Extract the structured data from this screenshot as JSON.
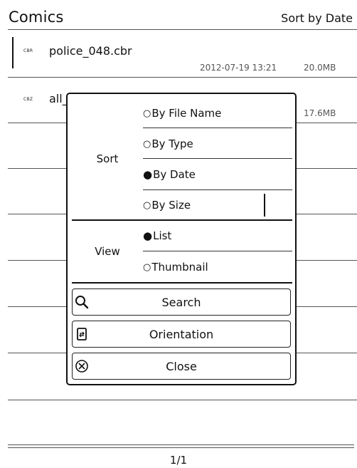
{
  "header": {
    "title": "Comics",
    "sort_label": "Sort by Date"
  },
  "files": [
    {
      "type": "CBR",
      "name": "police_048.cbr",
      "date": "2012-07-19 13:21",
      "size": "20.0MB"
    },
    {
      "type": "CBZ",
      "name": "all_",
      "size": "17.6MB"
    }
  ],
  "modal": {
    "sort_group_label": "Sort",
    "sort_options": [
      {
        "label": "By File Name",
        "selected": false
      },
      {
        "label": "By Type",
        "selected": false
      },
      {
        "label": "By Date",
        "selected": true
      },
      {
        "label": "By Size",
        "selected": false
      }
    ],
    "view_group_label": "View",
    "view_options": [
      {
        "label": "List",
        "selected": true
      },
      {
        "label": "Thumbnail",
        "selected": false
      }
    ],
    "buttons": {
      "search": "Search",
      "orientation": "Orientation",
      "close": "Close"
    },
    "marks": {
      "empty": "○",
      "filled": "●"
    }
  },
  "footer": {
    "page_indicator": "1/1"
  },
  "icons": {
    "search": "magnifier-icon",
    "orientation": "rotate-device-icon",
    "close": "circle-x-icon"
  }
}
